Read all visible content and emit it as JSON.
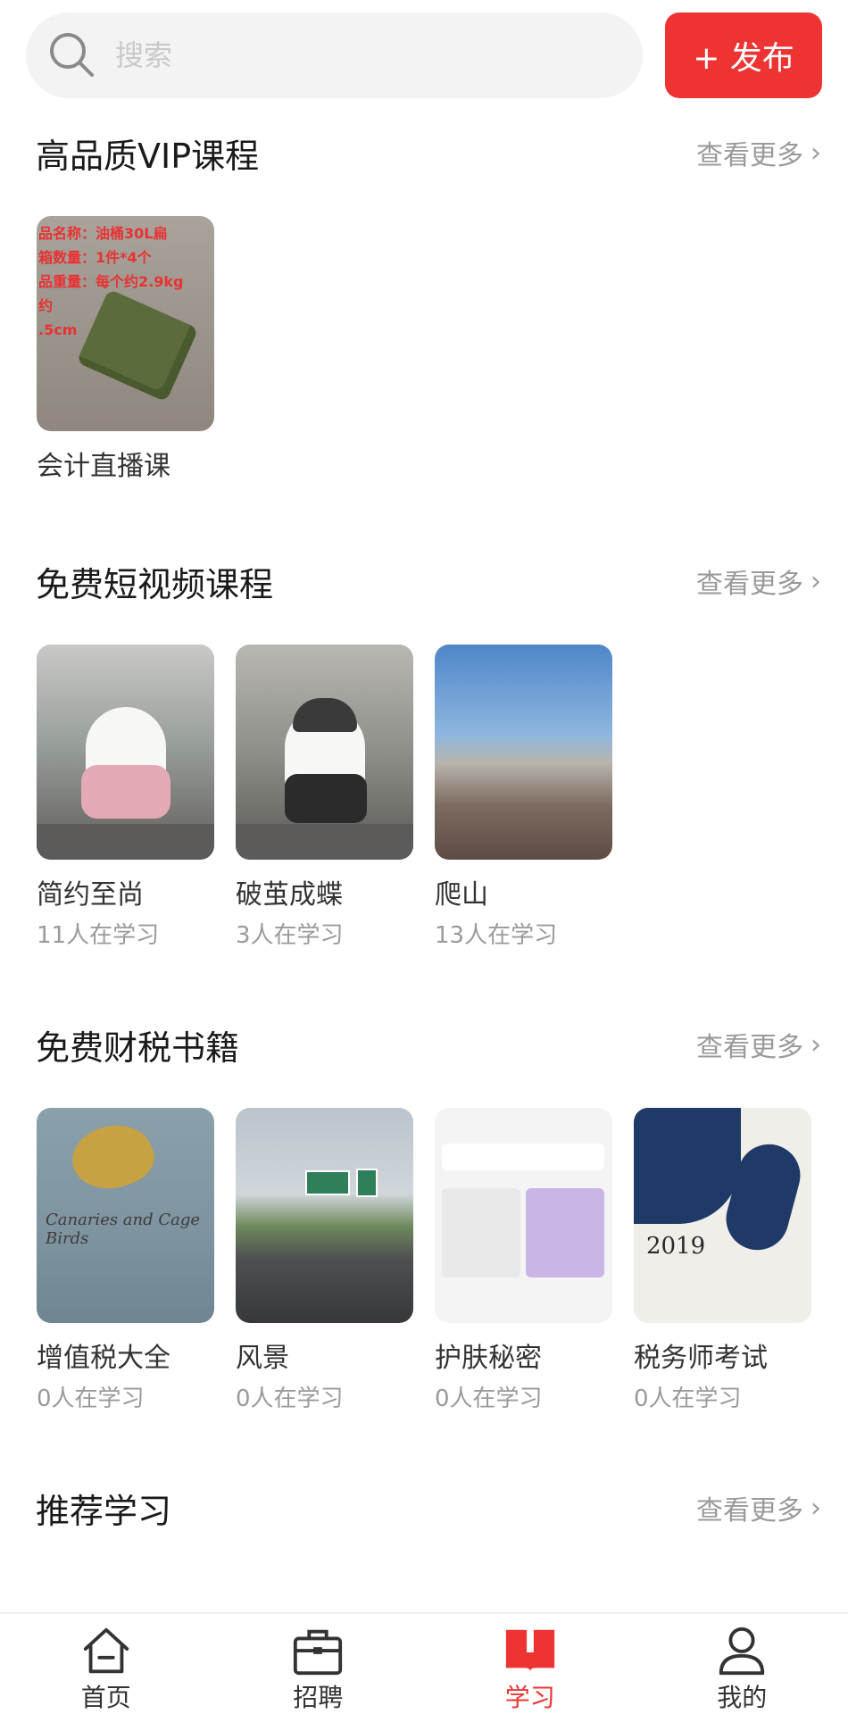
{
  "search": {
    "placeholder": "搜索"
  },
  "publish": {
    "label": "+ 发布"
  },
  "more_label": "查看更多",
  "sections": {
    "vip": {
      "title": "高品质VIP课程",
      "items": [
        {
          "title": "会计直播课",
          "image_text": [
            "品名称：油桶30L扁",
            "箱数量：1件*4个",
            "品重量：每个约2.9kg",
            "约",
            ".5cm"
          ]
        }
      ]
    },
    "video": {
      "title": "免费短视频课程",
      "items": [
        {
          "title": "简约至尚",
          "learners": "11人在学习"
        },
        {
          "title": "破茧成蝶",
          "learners": "3人在学习"
        },
        {
          "title": "爬山",
          "learners": "13人在学习"
        }
      ]
    },
    "books": {
      "title": "免费财税书籍",
      "items": [
        {
          "title": "增值税大全",
          "learners": "0人在学习",
          "image_text": "Canaries and Cage Birds"
        },
        {
          "title": "风景",
          "learners": "0人在学习"
        },
        {
          "title": "护肤秘密",
          "learners": "0人在学习"
        },
        {
          "title": "税务师考试",
          "learners": "0人在学习",
          "image_text": "2019"
        }
      ]
    },
    "recommend": {
      "title": "推荐学习"
    }
  },
  "tabbar": {
    "items": [
      {
        "label": "首页",
        "icon": "home-icon",
        "active": false
      },
      {
        "label": "招聘",
        "icon": "briefcase-icon",
        "active": false
      },
      {
        "label": "学习",
        "icon": "book-icon",
        "active": true
      },
      {
        "label": "我的",
        "icon": "user-icon",
        "active": false
      }
    ]
  },
  "colors": {
    "accent": "#ee3333",
    "muted": "#9a9a9a"
  }
}
